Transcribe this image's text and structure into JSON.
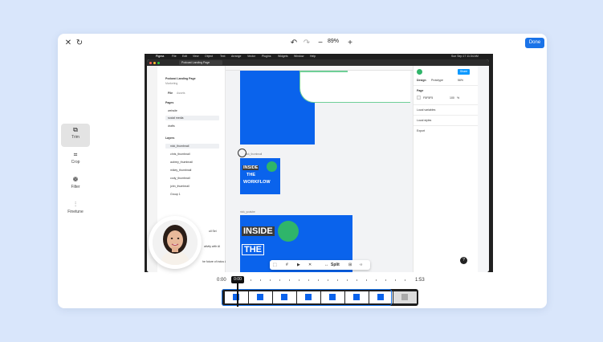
{
  "editor": {
    "zoom": "89%",
    "done_label": "Done",
    "icons": {
      "close": "close-icon",
      "redo": "redo-icon",
      "undo": "undo-icon",
      "zoom_out": "minus-icon",
      "zoom_in": "plus-icon"
    },
    "tools": [
      {
        "label": "Trim",
        "icon": "trim-icon",
        "active": true
      },
      {
        "label": "Crop",
        "icon": "crop-icon",
        "active": false
      },
      {
        "label": "Filter",
        "icon": "filter-icon",
        "active": false
      },
      {
        "label": "Finetune",
        "icon": "sliders-icon",
        "active": false
      }
    ]
  },
  "mac_menubar": {
    "app": "Figma",
    "items": [
      "File",
      "Edit",
      "View",
      "Object",
      "Text",
      "Arrange",
      "Vector",
      "Plugins",
      "Widgets",
      "Window",
      "Help"
    ],
    "clock": "Sun Sep 17 11:34 AM"
  },
  "figma": {
    "tab_title": "Podcast Landing Page",
    "file_name": "Podcast Landing Page",
    "team": "Marketing",
    "left_tabs": [
      "File",
      "Assets"
    ],
    "pages_header": "Pages",
    "pages": [
      "website",
      "social media",
      "drafts"
    ],
    "layers_header": "Layers",
    "layers": [
      "nick_thumbnail",
      "chris_thumbnail",
      "aubrey_thumbnail",
      "mikey_thumbnail",
      "cody_thumbnail",
      "john_thumbnail",
      "Group 1"
    ],
    "cutoff_text": [
      "ull Sei",
      "ativity with AI",
      "he future of indus AI"
    ],
    "canvas_labels": [
      "nick_thumbnail",
      "nick_youtube"
    ],
    "thumb_words": [
      "INSIDE",
      "THE",
      "WORKFLOW"
    ],
    "right_tabs": [
      "Design",
      "Prototype"
    ],
    "zoom": "56%",
    "share_label": "Share",
    "page_label": "Page",
    "page_color": "F5F5F5",
    "page_opacity": "100",
    "page_opacity_unit": "%",
    "sections": [
      "Local variables",
      "Local styles",
      "Export"
    ],
    "help": "?"
  },
  "floating_toolbar": {
    "split_label": "Split"
  },
  "timeline": {
    "start": "0:00",
    "current": "0:00",
    "end": "1:53",
    "playback_progress": 0
  },
  "colors": {
    "accent": "#1a73e8",
    "figma_blue": "#0a63ec",
    "green": "#2fb56a",
    "background": "#d9e6fb"
  }
}
